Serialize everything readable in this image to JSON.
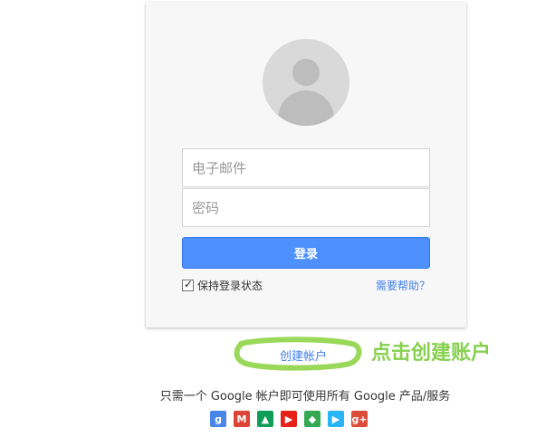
{
  "login": {
    "email_placeholder": "电子邮件",
    "password_placeholder": "密码",
    "signin_label": "登录",
    "stay_signed_in_label": "保持登录状态",
    "stay_signed_in_checked": true,
    "help_link": "需要帮助？"
  },
  "footer": {
    "create_account_link": "创建帐户",
    "annotation": "点击创建账户",
    "tagline": "只需一个 Google 帐户即可使用所有 Google 产品/服务"
  },
  "products": [
    {
      "name": "google-search-icon",
      "glyph": "g",
      "color": "#4a86e8"
    },
    {
      "name": "gmail-icon",
      "glyph": "M",
      "color": "#db4437"
    },
    {
      "name": "drive-icon",
      "glyph": "▲",
      "color": "#0f9d58"
    },
    {
      "name": "youtube-icon",
      "glyph": "▶",
      "color": "#e62117"
    },
    {
      "name": "maps-icon",
      "glyph": "◆",
      "color": "#34a853"
    },
    {
      "name": "play-icon",
      "glyph": "▶",
      "color": "#29b6f6"
    },
    {
      "name": "google-plus-icon",
      "glyph": "g+",
      "color": "#dd4b39"
    }
  ]
}
